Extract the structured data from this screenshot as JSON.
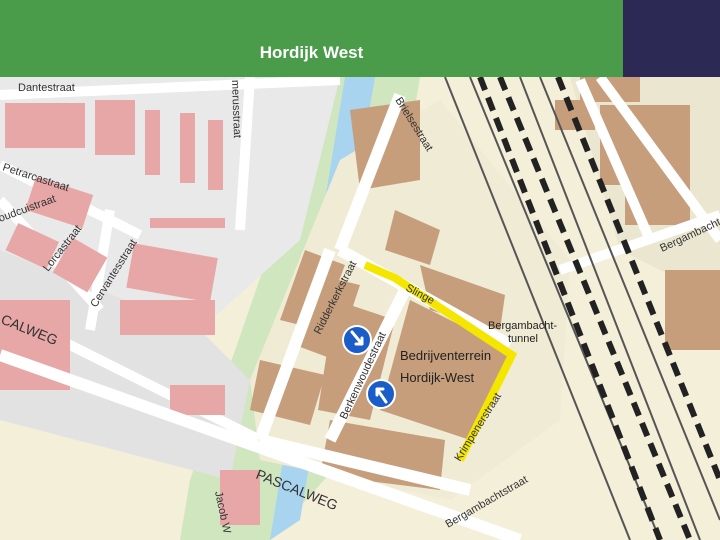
{
  "header": {
    "title": "Hordijk West",
    "colors": {
      "green": "#4a9c4a",
      "navy": "#2c2a54"
    }
  },
  "map": {
    "street_labels": {
      "dantestraat": "Dantestraat",
      "homerusstraat": "merusstraat",
      "brielsestraat": "Brielsestraat",
      "petrarcastraat": "Petrarcastraat",
      "boccaccio": "oudcuistraat",
      "lorcastraat": "Lorcastraat",
      "cervantesstraat": "Cervantesstraat",
      "ridderkerkstraat": "Ridderkerkstraat",
      "pascalweg_left": "CALWEG",
      "pascalweg_bottom": "PASCALWEG",
      "birkenwoudestraat": "Berkenwoudestraat",
      "slinge": "Slinge",
      "bergambacht_right": "Bergambacht",
      "jacob": "Jacob W",
      "bergambachtstraat": "Bergambachtstraat",
      "krimpen": "Krimpenerstraat"
    },
    "area_labels": {
      "tunnel_line1": "Bergambacht-",
      "tunnel_line2": "tunnel",
      "bedrijven": "Bedrijventerrein",
      "hordijk": "Hordijk-West"
    },
    "markers": [
      "one-way-arrow-down-icon",
      "one-way-arrow-up-icon"
    ],
    "route_color": "#f5e600"
  }
}
